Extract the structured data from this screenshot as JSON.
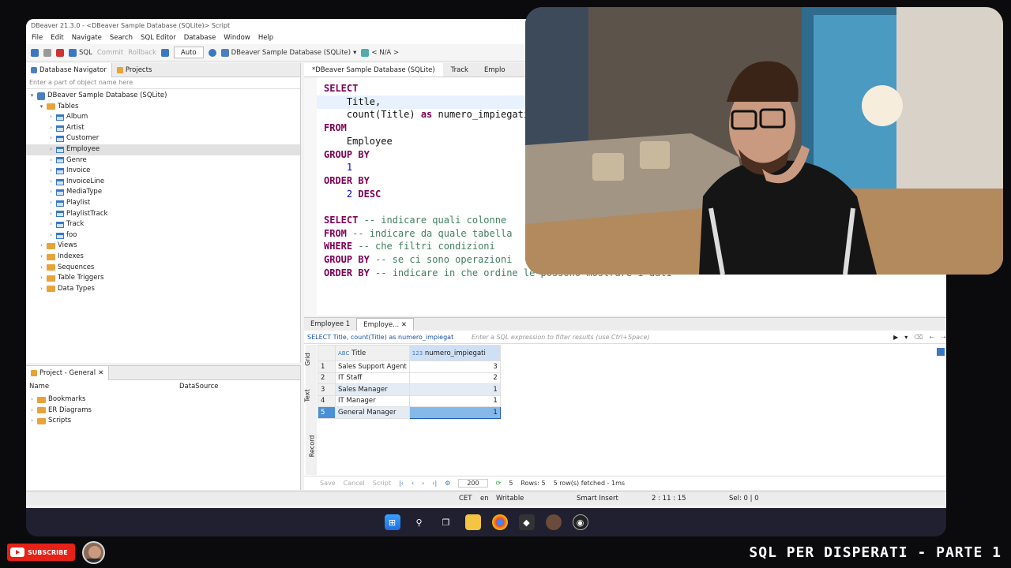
{
  "window": {
    "title": "DBeaver 21.3.0 - <DBeaver Sample Database (SQLite)> Script"
  },
  "menu": [
    "File",
    "Edit",
    "Navigate",
    "Search",
    "SQL Editor",
    "Database",
    "Window",
    "Help"
  ],
  "toolbar": {
    "sql": "SQL",
    "commit": "Commit",
    "rollback": "Rollback",
    "mode": "Auto",
    "datasource": "DBeaver Sample Database (SQLite)",
    "schema": "< N/A >"
  },
  "navigator": {
    "tabs": [
      "Database Navigator",
      "Projects"
    ],
    "filter_placeholder": "Enter a part of object name here",
    "db": "DBeaver Sample Database (SQLite)",
    "tables_label": "Tables",
    "tables": [
      "Album",
      "Artist",
      "Customer",
      "Employee",
      "Genre",
      "Invoice",
      "InvoiceLine",
      "MediaType",
      "Playlist",
      "PlaylistTrack",
      "Track",
      "foo"
    ],
    "folders": [
      "Views",
      "Indexes",
      "Sequences",
      "Table Triggers",
      "Data Types"
    ]
  },
  "project": {
    "title": "Project - General",
    "col_name": "Name",
    "col_ds": "DataSource",
    "items": [
      "Bookmarks",
      "ER Diagrams",
      "Scripts"
    ]
  },
  "editor": {
    "tabs": [
      "*DBeaver Sample Database (SQLite)",
      "Track",
      "Emplo"
    ]
  },
  "results": {
    "tabs": [
      "Employee 1",
      "Employe..."
    ],
    "query": "SELECT Title, count(Title) as numero_impiegat",
    "filter_placeholder": "Enter a SQL expression to filter results (use Ctrl+Space)",
    "columns": [
      "Title",
      "numero_impiegati"
    ],
    "rows": [
      {
        "n": "1",
        "title": "Sales Support Agent",
        "count": "3"
      },
      {
        "n": "2",
        "title": "IT Staff",
        "count": "2"
      },
      {
        "n": "3",
        "title": "Sales Manager",
        "count": "1"
      },
      {
        "n": "4",
        "title": "IT Manager",
        "count": "1"
      },
      {
        "n": "5",
        "title": "General Manager",
        "count": "1"
      }
    ],
    "side_tabs": [
      "Grid",
      "Text",
      "Record"
    ],
    "footer": {
      "save": "Save",
      "cancel": "Cancel",
      "script": "Script",
      "fetch_size": "200",
      "count": "5",
      "rows": "Rows: 5",
      "fetched": "5 row(s) fetched - 1ms"
    }
  },
  "status": {
    "tz": "CET",
    "locale": "en",
    "mode": "Writable",
    "insert": "Smart Insert",
    "pos": "2 : 11 : 15",
    "sel": "Sel: 0 | 0"
  },
  "overlay": {
    "subscribe": "SUBSCRIBE",
    "series": "SQL PER DISPERATI - PARTE 1"
  }
}
